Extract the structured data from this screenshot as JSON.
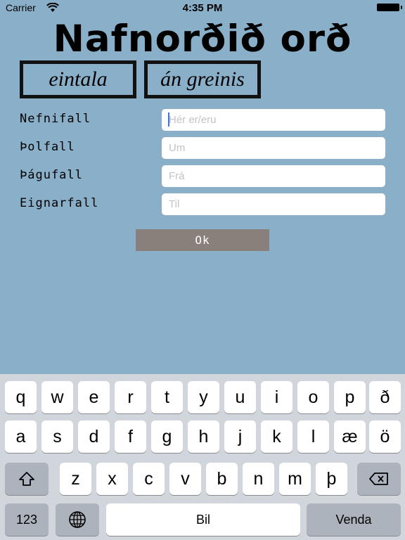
{
  "status_bar": {
    "carrier": "Carrier",
    "time": "4:35 PM"
  },
  "title": "Nafnorðið orð",
  "tags": {
    "number": "eintala",
    "article": "án greinis"
  },
  "cases": [
    {
      "label": "Nefnifall",
      "placeholder": "Hér er/eru",
      "value": ""
    },
    {
      "label": "Þolfall",
      "placeholder": "Um",
      "value": ""
    },
    {
      "label": "Þágufall",
      "placeholder": "Frá",
      "value": ""
    },
    {
      "label": "Eignarfall",
      "placeholder": "Til",
      "value": ""
    }
  ],
  "ok_label": "Ok",
  "keyboard": {
    "row1": [
      "q",
      "w",
      "e",
      "r",
      "t",
      "y",
      "u",
      "i",
      "o",
      "p",
      "ð"
    ],
    "row2": [
      "a",
      "s",
      "d",
      "f",
      "g",
      "h",
      "j",
      "k",
      "l",
      "æ",
      "ö"
    ],
    "row3": [
      "z",
      "x",
      "c",
      "v",
      "b",
      "n",
      "m",
      "þ"
    ],
    "numbers_label": "123",
    "space_label": "Bil",
    "return_label": "Venda",
    "icons": {
      "shift": "shift-arrow-icon",
      "delete": "backspace-icon",
      "globe": "globe-icon"
    }
  },
  "colors": {
    "background": "#8aafc8",
    "ok_button": "#8a807b",
    "keyboard": "#d1d5dc",
    "caret": "#3478f6"
  }
}
